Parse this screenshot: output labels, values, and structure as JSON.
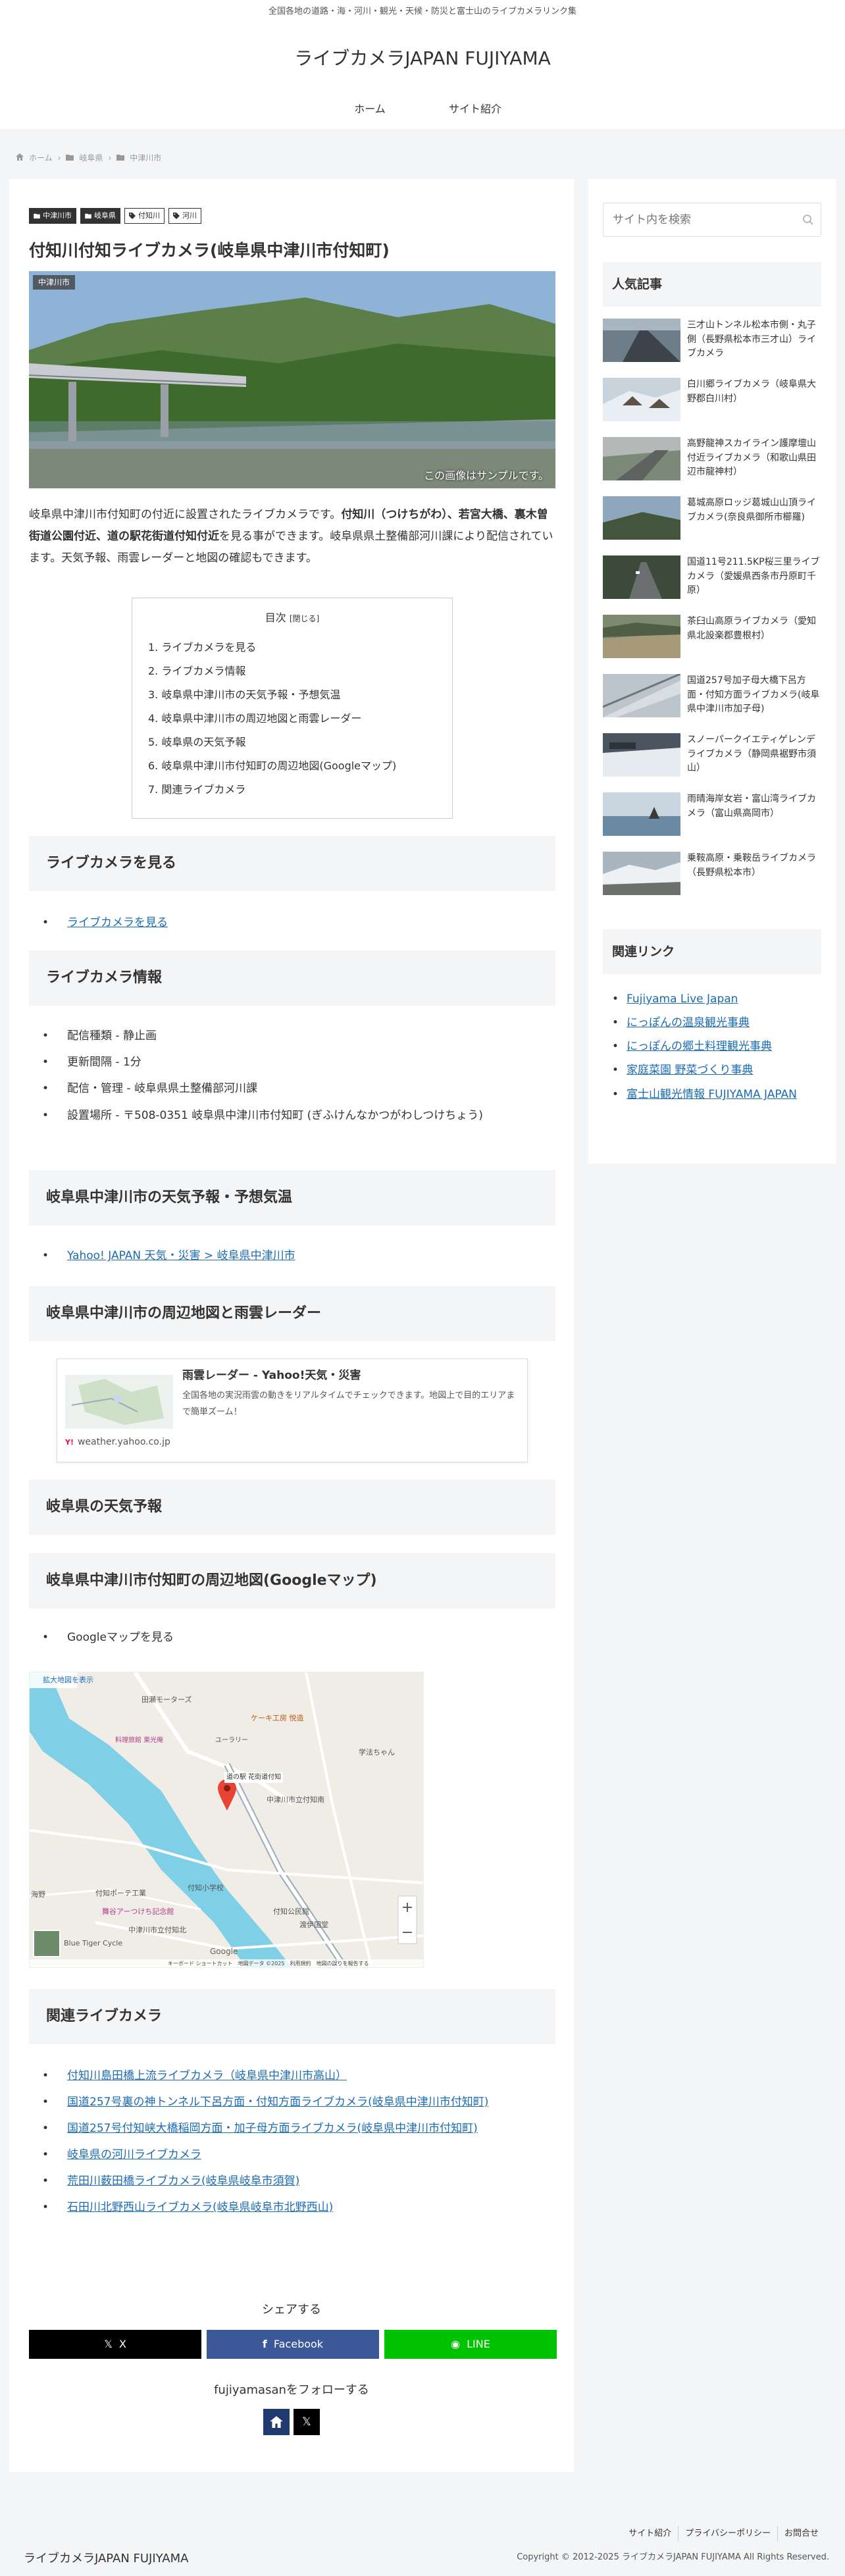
{
  "header": {
    "tagline": "全国各地の道路・海・河川・観光・天候・防災と富士山のライブカメラリンク集",
    "site_title": "ライブカメラJAPAN FUJIYAMA",
    "nav": [
      {
        "label": "ホーム"
      },
      {
        "label": "サイト紹介"
      }
    ]
  },
  "breadcrumb": {
    "home": "ホーム",
    "level1": "岐阜県",
    "level2": "中津川市"
  },
  "article": {
    "categories": [
      {
        "label": "中津川市",
        "style": "dark"
      },
      {
        "label": "岐阜県",
        "style": "dark"
      },
      {
        "label": "付知川",
        "style": "light"
      },
      {
        "label": "河川",
        "style": "light"
      }
    ],
    "title": "付知川付知ライブカメラ(岐阜県中津川市付知町)",
    "eyecatch_label": "中津川市",
    "eyecatch_note": "この画像はサンプルです。",
    "intro_1": "岐阜県中津川市付知町の付近に設置されたライブカメラです。",
    "intro_bold": "付知川（つけちがわ）、若宮大橋、裏木曽街道公園付近、道の駅花街道付知付近",
    "intro_2": "を見る事ができます。岐阜県県土整備部河川課により配信されています。天気予報、雨雲レーダーと地図の確認もできます。",
    "toc_title": "目次",
    "toc_toggle": "[閉じる]",
    "toc": [
      "1. ライブカメラを見る",
      "2. ライブカメラ情報",
      "3. 岐阜県中津川市の天気予報・予想気温",
      "4. 岐阜県中津川市の周辺地図と雨雲レーダー",
      "5. 岐阜県の天気予報",
      "6. 岐阜県中津川市付知町の周辺地図(Googleマップ)",
      "7. 関連ライブカメラ"
    ],
    "h_view": "ライブカメラを見る",
    "view_link": "ライブカメラを見る",
    "h_info": "ライブカメラ情報",
    "info": [
      "配信種類 - 静止画",
      "更新間隔 - 1分",
      "配信・管理 - 岐阜県県土整備部河川課",
      "設置場所 - 〒508-0351 岐阜県中津川市付知町 (ぎふけんなかつがわしつけちょう)"
    ],
    "h_weather": "岐阜県中津川市の天気予報・予想気温",
    "weather_link": "Yahoo! JAPAN 天気・災害 > 岐阜県中津川市",
    "h_radar": "岐阜県中津川市の周辺地図と雨雲レーダー",
    "card": {
      "title": "雨雲レーダー - Yahoo!天気・災害",
      "desc": "全国各地の実況雨雲の動きをリアルタイムでチェックできます。地図上で目的エリアまで簡単ズーム！",
      "domain": "weather.yahoo.co.jp"
    },
    "h_pref_weather": "岐阜県の天気予報",
    "h_map": "岐阜県中津川市付知町の周辺地図(Googleマップ)",
    "map_item": "Googleマップを見る",
    "map": {
      "enlarge": "拡大地図を表示",
      "place": "道の駅 花街道付知",
      "labels": [
        "ケーキ工房 悦造",
        "中津川市立付知南",
        "田瀬モーターズ",
        "料理旅館 東光庵",
        "ユーラリー",
        "付知小学校",
        "付知ポーテ工業",
        "舞谷アーつけち記念館",
        "海野",
        "中津川市立付知北",
        "学法ちゃん",
        "渡伊国堂",
        "付知公民館",
        "Blue Tiger Cycle",
        "Google",
        "キーボード ショートカット",
        "地図データ ©2025",
        "利用規約",
        "地図の誤りを報告する"
      ]
    },
    "h_related": "関連ライブカメラ",
    "related": [
      "付知川島田橋上流ライブカメラ（岐阜県中津川市高山）",
      "国道257号裏の神トンネル下呂方面・付知方面ライブカメラ(岐阜県中津川市付知町)",
      "国道257号付知峡大橋稲岡方面・加子母方面ライブカメラ(岐阜県中津川市付知町)",
      "岐阜県の河川ライブカメラ",
      "荒田川薮田橋ライブカメラ(岐阜県岐阜市須賀)",
      "石田川北野西山ライブカメラ(岐阜県岐阜市北野西山)"
    ],
    "share_title": "シェアする",
    "share": [
      {
        "label": "X",
        "color": "#000000"
      },
      {
        "label": "Facebook",
        "color": "#3b5998"
      },
      {
        "label": "LINE",
        "color": "#00c300"
      }
    ],
    "follow_title": "fujiyamasanをフォローする"
  },
  "sidebar": {
    "search_placeholder": "サイト内を検索",
    "popular_title": "人気記事",
    "popular": [
      "三才山トンネル松本市側・丸子側（長野県松本市三才山）ライブカメラ",
      "白川郷ライブカメラ（岐阜県大野郡白川村）",
      "高野龍神スカイライン護摩壇山付近ライブカメラ（和歌山県田辺市龍神村）",
      "葛城高原ロッジ葛城山山頂ライブカメラ(奈良県御所市櫛羅)",
      "国道11号211.5KP桜三里ライブカメラ（愛媛県西条市丹原町千原）",
      "茶臼山高原ライブカメラ（愛知県北設楽郡豊根村）",
      "国道257号加子母大橋下呂方面・付知方面ライブカメラ(岐阜県中津川市加子母)",
      "スノーパークイエティゲレンデライブカメラ（静岡県裾野市須山）",
      "雨晴海岸女岩・富山湾ライブカメラ（富山県高岡市）",
      "乗鞍高原・乗鞍岳ライブカメラ（長野県松本市）"
    ],
    "links_title": "関連リンク",
    "links": [
      "Fujiyama Live Japan",
      "にっぽんの温泉観光事典",
      "にっぽんの郷土料理観光事典",
      "家庭菜園 野菜づくり事典",
      "富士山観光情報 FUJIYAMA JAPAN"
    ]
  },
  "footer": {
    "nav": [
      "サイト紹介",
      "プライバシーポリシー",
      "お問合せ"
    ],
    "logo": "ライブカメラJAPAN FUJIYAMA",
    "copyright": "Copyright © 2012-2025 ライブカメラJAPAN FUJIYAMA All Rights Reserved."
  },
  "colors": {
    "accent": "#1a6bb5",
    "heading_bg": "#f4f5f7",
    "x": "#000000",
    "facebook": "#3b5998",
    "line": "#00c300"
  }
}
